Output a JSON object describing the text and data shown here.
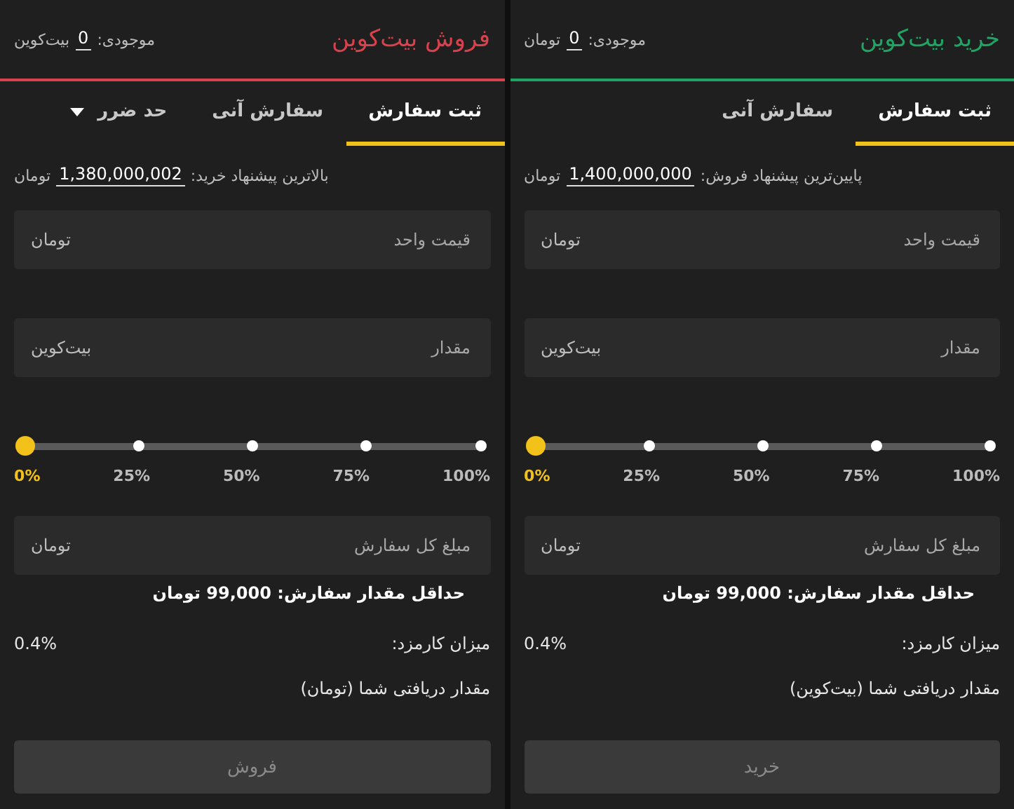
{
  "panels": [
    {
      "title": "خرید بیت‌کوین",
      "color": "#1fa463",
      "balance": {
        "label": "موجودی:",
        "value": "0",
        "unit": "تومان"
      },
      "tabs": [
        {
          "label": "ثبت سفارش",
          "selected": true,
          "kind": "tab"
        },
        {
          "label": "سفارش آنی",
          "selected": false,
          "kind": "tab"
        }
      ],
      "best_offer": {
        "label": "پایین‌ترین پیشنهاد فروش:",
        "value": "1,400,000,000",
        "unit": "تومان"
      },
      "fields": [
        {
          "placeholder": "قیمت واحد",
          "unit": "تومان"
        },
        {
          "placeholder": "مقدار",
          "unit": "بیت‌کوین"
        }
      ],
      "slider": {
        "level": 0,
        "labels": [
          "100%",
          "75%",
          "50%",
          "25%",
          "0%"
        ]
      },
      "total": {
        "placeholder": "مبلغ کل سفارش",
        "unit": "تومان"
      },
      "min_order": "حداقل مقدار سفارش: 99,000 تومان",
      "fee": {
        "label": "میزان کارمزد:",
        "value": "0.4%"
      },
      "receive": "مقدار دریافتی شما (بیت‌کوین)",
      "button": {
        "label": "خرید",
        "disabled": true
      }
    },
    {
      "title": "فروش بیت‌کوین",
      "color": "#d9414c",
      "balance": {
        "label": "موجودی:",
        "value": "0",
        "unit": "بیت‌کوین"
      },
      "tabs": [
        {
          "label": "ثبت سفارش",
          "selected": true,
          "kind": "tab"
        },
        {
          "label": "سفارش آنی",
          "selected": false,
          "kind": "tab"
        },
        {
          "label": "حد ضرر",
          "selected": false,
          "kind": "dropdown"
        }
      ],
      "best_offer": {
        "label": "بالاترین پیشنهاد خرید:",
        "value": "1,380,000,002",
        "unit": "تومان"
      },
      "fields": [
        {
          "placeholder": "قیمت واحد",
          "unit": "تومان"
        },
        {
          "placeholder": "مقدار",
          "unit": "بیت‌کوین"
        }
      ],
      "slider": {
        "level": 0,
        "labels": [
          "100%",
          "75%",
          "50%",
          "25%",
          "0%"
        ]
      },
      "total": {
        "placeholder": "مبلغ کل سفارش",
        "unit": "تومان"
      },
      "min_order": "حداقل مقدار سفارش: 99,000 تومان",
      "fee": {
        "label": "میزان کارمزد:",
        "value": "0.4%"
      },
      "receive": "مقدار دریافتی شما (تومان)",
      "button": {
        "label": "فروش",
        "disabled": true
      }
    }
  ]
}
